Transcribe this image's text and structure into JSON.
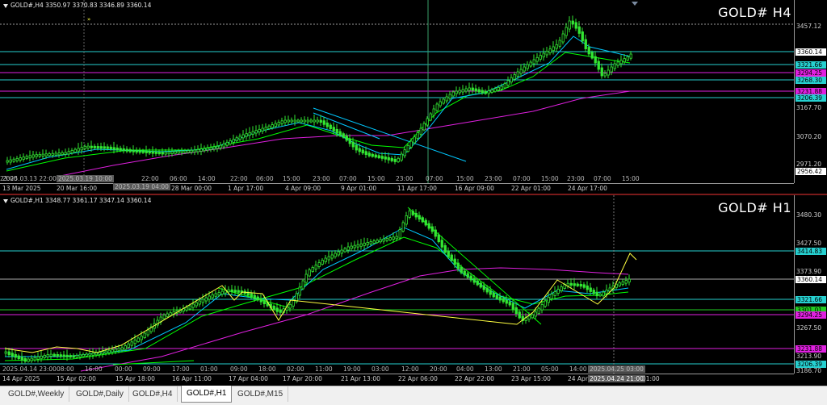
{
  "windows": [
    {
      "id": "h4",
      "info": "GOLD#,H4  3350.97 3370.83 3346.89 3360.14",
      "symbol": "GOLD# H4",
      "price_ticks": [
        "3457.12",
        "3167.70",
        "3070.20",
        "2971.20"
      ],
      "price_tags": [
        {
          "text": "3360.14",
          "bg": "#ffffff",
          "fg": "#000000"
        },
        {
          "text": "3321.66",
          "bg": "#26d0d0",
          "fg": "#000000"
        },
        {
          "text": "3294.25",
          "bg": "#e020e0",
          "fg": "#000000"
        },
        {
          "text": "3268.30",
          "bg": "#26d0d0",
          "fg": "#000000"
        },
        {
          "text": "3231.88",
          "bg": "#e020e0",
          "fg": "#000000"
        },
        {
          "text": "3206.39",
          "bg": "#26d0d0",
          "fg": "#000000"
        },
        {
          "text": "2956.42",
          "bg": "#ffffff",
          "fg": "#000000"
        }
      ],
      "time_ticks": [
        "13 Mar 2025",
        "20 Mar 16:00",
        "25 Mar 08:00",
        "28 Mar 00:00",
        "1 Apr 17:00",
        "4 Apr 09:00",
        "9 Apr 01:00",
        "11 Apr 17:00",
        "16 Apr 09:00",
        "22 Apr 01:00",
        "24 Apr 17:00"
      ],
      "overlay_times": [
        "2025.03.19 10:00",
        "2025.03.19 04:00",
        "22:00",
        "06:00",
        "14:00",
        "22:00",
        "06:00",
        "15:00",
        "23:00",
        "07:00",
        "15:00",
        "23:00",
        "07:00",
        "15:00",
        "23:00",
        "07:00",
        "15:00",
        "23:00",
        "07:00",
        "15:00",
        "23:00"
      ],
      "overlay_first": "2025.03.13 22:00"
    },
    {
      "id": "h1",
      "info": "GOLD#,H1  3348.77 3361.17 3347.14 3360.14",
      "symbol": "GOLD# H1",
      "price_ticks": [
        "3480.30",
        "3427.50",
        "3373.90",
        "3267.50",
        "3213.90",
        "3186.70"
      ],
      "price_tags": [
        {
          "text": "3414.83",
          "bg": "#26d0d0",
          "fg": "#000000"
        },
        {
          "text": "3360.14",
          "bg": "#ffffff",
          "fg": "#000000"
        },
        {
          "text": "3321.66",
          "bg": "#26d0d0",
          "fg": "#000000"
        },
        {
          "text": "3301.01",
          "bg": "#22cc22",
          "fg": "#000000"
        },
        {
          "text": "3294.25",
          "bg": "#e020e0",
          "fg": "#000000"
        },
        {
          "text": "3231.88",
          "bg": "#e020e0",
          "fg": "#000000"
        },
        {
          "text": "3206.39",
          "bg": "#26d0d0",
          "fg": "#000000"
        }
      ],
      "time_ticks": [
        "14 Apr 2025",
        "15 Apr 02:00",
        "15 Apr 18:00",
        "16 Apr 11:00",
        "17 Apr 04:00",
        "17 Apr 20:00",
        "21 Apr 13:00",
        "22 Apr 06:00",
        "22 Apr 22:00",
        "23 Apr 15:00",
        "24 Apr",
        "2025.04.24 21:00",
        "01:00"
      ],
      "overlay_times": [
        "2025.04.25 03:00",
        "08:00",
        "16:00",
        "00:00",
        "09:00",
        "17:00",
        "01:00",
        "09:00",
        "18:00",
        "02:00",
        "11:00",
        "19:00",
        "03:00",
        "12:00",
        "20:00",
        "04:00",
        "13:00",
        "21:00",
        "05:00",
        "14:00"
      ],
      "overlay_first": "2025.04.14 23:00"
    }
  ],
  "tabs": [
    "GOLD#,Weekly",
    "GOLD#,Daily",
    "GOLD#,H4",
    "GOLD#,H1",
    "GOLD#,M15"
  ],
  "active_tab": "GOLD#,H1",
  "colors": {
    "candle": "#32e632",
    "ma_fast": "#00c8ff",
    "ma_mid": "#00ff00",
    "ma_slow": "#e020e0",
    "zigzag": "#ffff40",
    "level_cyan": "#26d0d0",
    "level_magenta": "#e020e0"
  }
}
